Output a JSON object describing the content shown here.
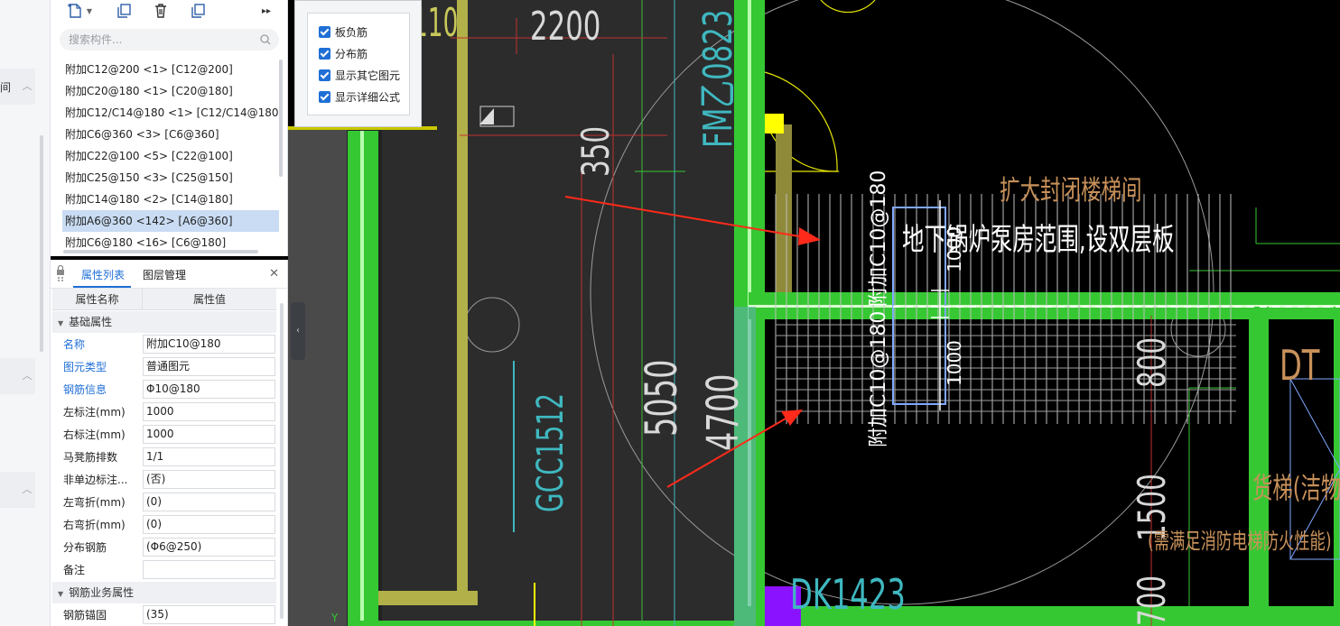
{
  "left_strip": {
    "items": [
      {
        "label": "间"
      },
      {
        "label": ""
      },
      {
        "label": ""
      }
    ]
  },
  "component_panel": {
    "search_placeholder": "搜索构件...",
    "items": [
      {
        "label": "附加C12@200 <1> [C12@200]"
      },
      {
        "label": "附加C20@180 <1> [C20@180]"
      },
      {
        "label": "附加C12/C14@180 <1> [C12/C14@180]"
      },
      {
        "label": "附加C6@360 <3> [C6@360]"
      },
      {
        "label": "附加C22@100 <5> [C22@100]"
      },
      {
        "label": "附加C25@150 <3> [C25@150]"
      },
      {
        "label": "附加C14@180 <2> [C14@180]"
      },
      {
        "label": "附加A6@360 <142> [A6@360]"
      },
      {
        "label": "附加C6@180 <16> [C6@180]"
      }
    ],
    "selected_index": 7
  },
  "property_panel": {
    "tabs": [
      "属性列表",
      "图层管理"
    ],
    "active_tab": 0,
    "columns": [
      "属性名称",
      "属性值"
    ],
    "sections": [
      {
        "title": "基础属性",
        "rows": [
          {
            "name": "名称",
            "value": "附加C10@180",
            "blue": true
          },
          {
            "name": "图元类型",
            "value": "普通图元",
            "blue": true
          },
          {
            "name": "钢筋信息",
            "value": "Φ10@180",
            "blue": true
          },
          {
            "name": "左标注(mm)",
            "value": "1000",
            "blue": false
          },
          {
            "name": "右标注(mm)",
            "value": "1000",
            "blue": false
          },
          {
            "name": "马凳筋排数",
            "value": "1/1",
            "blue": false
          },
          {
            "name": "非单边标注...",
            "value": "(否)",
            "blue": false
          },
          {
            "name": "左弯折(mm)",
            "value": "(0)",
            "blue": false
          },
          {
            "name": "右弯折(mm)",
            "value": "(0)",
            "blue": false
          },
          {
            "name": "分布钢筋",
            "value": "(Φ6@250)",
            "blue": false
          },
          {
            "name": "备注",
            "value": "",
            "blue": false
          }
        ]
      },
      {
        "title": "钢筋业务属性",
        "rows": [
          {
            "name": "钢筋锚固",
            "value": "(35)",
            "blue": false
          }
        ]
      }
    ]
  },
  "popup": {
    "options": [
      {
        "label": "板负筋",
        "checked": true
      },
      {
        "label": "分布筋",
        "checked": true
      },
      {
        "label": "显示其它图元",
        "checked": true
      },
      {
        "label": "显示详细公式",
        "checked": true
      }
    ]
  },
  "cad_text": {
    "dim_2200": "2200",
    "dim_350": "350",
    "dim_5050": "5050",
    "dim_4700": "4700",
    "label_fm": "FM乙0823",
    "label_gcc": "GCC1512",
    "label_stair": "扩大封闭楼梯间",
    "label_boiler": "地下锅炉泵房范围,设双层板",
    "rebar_label_1": "附加C10@180",
    "rebar_label_2": "附加C10@180",
    "dim_1000_top": "1000",
    "dim_1000_bottom": "1000",
    "dim_800": "800",
    "dim_1500": "1500",
    "dim_700": "700",
    "label_dk": "DK1423",
    "label_dt": "DT",
    "label_lift": "货梯(洁物",
    "label_fire": "(需满足消防电梯防火性能)",
    "axis_y": "Y"
  },
  "colors": {
    "wall_green": "#36c832",
    "wall_olive": "#b2b049",
    "selection_blue": "#c9dcf3",
    "accent_blue": "#1f6fd6",
    "arrow_red": "#ff2a1a"
  }
}
